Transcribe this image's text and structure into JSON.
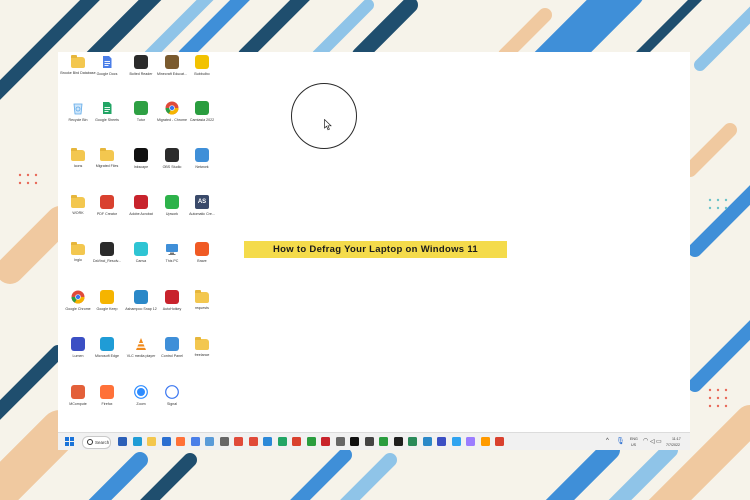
{
  "page": {
    "title": "How to Defrag Your Laptop on Windows 11"
  },
  "desktop": {
    "icons": [
      {
        "label": "Brooke Bird Database",
        "type": "folder",
        "color": "#f3c74f"
      },
      {
        "label": "Google Docs",
        "type": "doc",
        "color": "#4a7ee8"
      },
      {
        "label": "Bolted Reader",
        "type": "app",
        "color": "#2b2b2b"
      },
      {
        "label": "Minecraft Educat...",
        "type": "app",
        "color": "#7a5a2e"
      },
      {
        "label": "Bubbulbo",
        "type": "app",
        "color": "#f2c200"
      },
      {
        "label": "Recycle Bin",
        "type": "recycle",
        "color": "#5ea9e8"
      },
      {
        "label": "Google Sheets",
        "type": "sheet",
        "color": "#22a565"
      },
      {
        "label": "Tutor",
        "type": "app",
        "color": "#2ea043"
      },
      {
        "label": "Migrated - Chrome",
        "type": "chrome",
        "color": "#e04a3a"
      },
      {
        "label": "Camtasia 2022",
        "type": "app",
        "color": "#2a9d3f"
      },
      {
        "label": "Icons",
        "type": "folder",
        "color": "#f3c74f"
      },
      {
        "label": "Migrated Files",
        "type": "folder",
        "color": "#f3c74f"
      },
      {
        "label": "Inkscape",
        "type": "app",
        "color": "#111111"
      },
      {
        "label": "OBS Studio",
        "type": "app",
        "color": "#2b2b2b"
      },
      {
        "label": "Network",
        "type": "app",
        "color": "#3f8fd8"
      },
      {
        "label": "WORK",
        "type": "folder",
        "color": "#f3c74f"
      },
      {
        "label": "PDF Creator",
        "type": "app",
        "color": "#d9412f"
      },
      {
        "label": "Adobe Acrobat",
        "type": "app",
        "color": "#c8232c"
      },
      {
        "label": "Upwork",
        "type": "app",
        "color": "#2db24a"
      },
      {
        "label": "Automatic Cre...",
        "type": "as",
        "color": "#3a4a6a"
      },
      {
        "label": "Inglo",
        "type": "folder",
        "color": "#f3c74f"
      },
      {
        "label": "DaVinci_Resolv...",
        "type": "app",
        "color": "#2b2b2b"
      },
      {
        "label": "Canva",
        "type": "app",
        "color": "#2ec4d3"
      },
      {
        "label": "This PC",
        "type": "pc",
        "color": "#3f8fd8"
      },
      {
        "label": "Brave",
        "type": "app",
        "color": "#f05a24"
      },
      {
        "label": "Google Chrome",
        "type": "chrome",
        "color": "#e04a3a"
      },
      {
        "label": "Google Keep",
        "type": "app",
        "color": "#f5b400"
      },
      {
        "label": "Ashampoo Snap 12",
        "type": "app",
        "color": "#2a88c8"
      },
      {
        "label": "AutoHotkey",
        "type": "app",
        "color": "#c8232c"
      },
      {
        "label": "requests",
        "type": "folder",
        "color": "#f3c74f"
      },
      {
        "label": "Lumen",
        "type": "app",
        "color": "#3b4fc4"
      },
      {
        "label": "Microsoft Edge",
        "type": "app",
        "color": "#1f9cd6"
      },
      {
        "label": "VLC media player",
        "type": "vlc",
        "color": "#f08a1c"
      },
      {
        "label": "Control Panel",
        "type": "app",
        "color": "#3f8fd8"
      },
      {
        "label": "freelance",
        "type": "folder",
        "color": "#f3c74f"
      },
      {
        "label": "MCompute",
        "type": "app",
        "color": "#e3603a"
      },
      {
        "label": "Firefox",
        "type": "app",
        "color": "#ff7139"
      },
      {
        "label": "Zoom",
        "type": "zoom",
        "color": "#2d8cff"
      },
      {
        "label": "Signal",
        "type": "signal",
        "color": "#3a76f0"
      }
    ]
  },
  "taskbar": {
    "search_label": "Search",
    "apps": [
      {
        "name": "word-icon",
        "color": "#2b5fb8"
      },
      {
        "name": "edge-icon",
        "color": "#1f9cd6"
      },
      {
        "name": "file-explorer-icon",
        "color": "#f3c74f"
      },
      {
        "name": "store-icon",
        "color": "#2b6fd1"
      },
      {
        "name": "firefox-icon",
        "color": "#ff7139"
      },
      {
        "name": "doc-icon",
        "color": "#4a7ee8"
      },
      {
        "name": "notepad-icon",
        "color": "#5a9bd8"
      },
      {
        "name": "pen-icon",
        "color": "#666666"
      },
      {
        "name": "app-icon",
        "color": "#e04a3a"
      },
      {
        "name": "chrome-icon",
        "color": "#e04a3a"
      },
      {
        "name": "vscode-icon",
        "color": "#2b88d8"
      },
      {
        "name": "sheets-icon",
        "color": "#22a565"
      },
      {
        "name": "photos-icon",
        "color": "#d9412f"
      },
      {
        "name": "camtasia-icon",
        "color": "#2a9d3f"
      },
      {
        "name": "acrobat-icon",
        "color": "#c8232c"
      },
      {
        "name": "settings-icon",
        "color": "#666666"
      },
      {
        "name": "inkscape-icon",
        "color": "#111111"
      },
      {
        "name": "chat-icon",
        "color": "#444444"
      },
      {
        "name": "camtasia2-icon",
        "color": "#2a9d3f"
      },
      {
        "name": "terminal-icon",
        "color": "#1f1f1f"
      },
      {
        "name": "app2-icon",
        "color": "#2a8a5a"
      },
      {
        "name": "snap-icon",
        "color": "#2a88c8"
      },
      {
        "name": "media-icon",
        "color": "#3b4fc4"
      },
      {
        "name": "ps-icon",
        "color": "#2fa3f0"
      },
      {
        "name": "pr-icon",
        "color": "#9b7cff"
      },
      {
        "name": "ai-icon",
        "color": "#ff9a00"
      },
      {
        "name": "pdf-icon",
        "color": "#d9412f"
      }
    ],
    "tray": {
      "lang_top": "ENG",
      "lang_bottom": "US",
      "time": "11:17",
      "date": "7/7/2022"
    }
  },
  "colors": {
    "banner": "#f4db4b",
    "start": "#1a73d9"
  }
}
